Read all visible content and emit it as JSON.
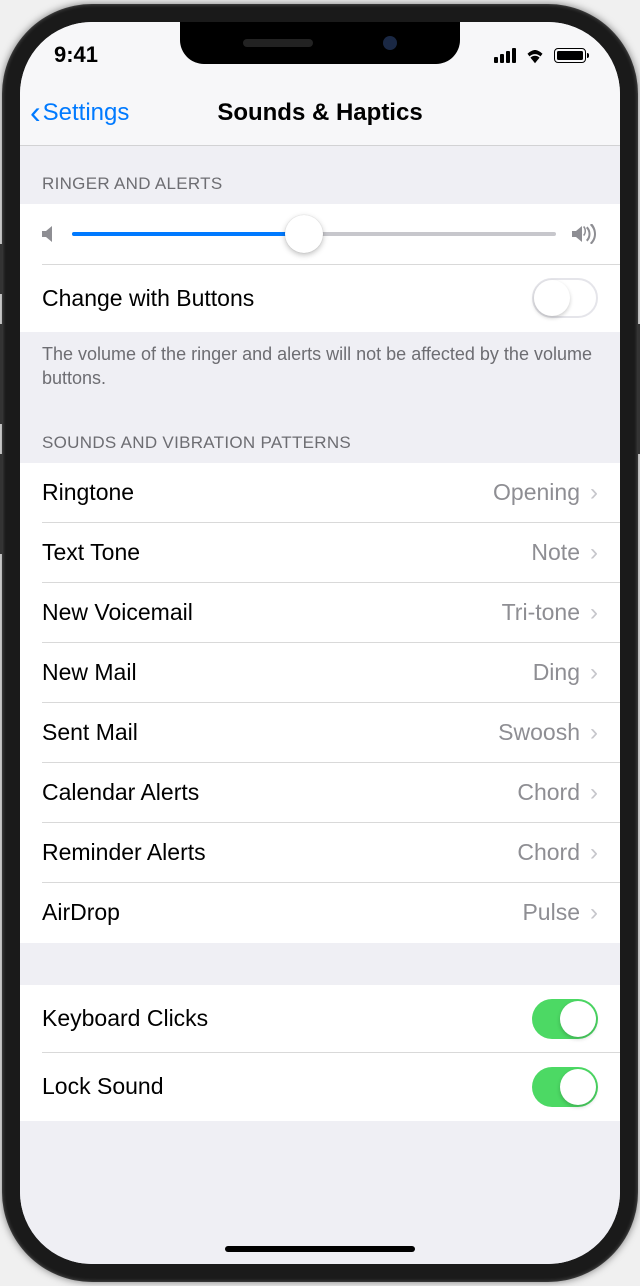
{
  "status": {
    "time": "9:41"
  },
  "nav": {
    "back_label": "Settings",
    "title": "Sounds & Haptics"
  },
  "ringer": {
    "header": "RINGER AND ALERTS",
    "change_with_buttons_label": "Change with Buttons",
    "change_with_buttons_on": false,
    "volume_percent": 48,
    "footer": "The volume of the ringer and alerts will not be affected by the volume buttons."
  },
  "patterns": {
    "header": "SOUNDS AND VIBRATION PATTERNS",
    "items": [
      {
        "label": "Ringtone",
        "value": "Opening"
      },
      {
        "label": "Text Tone",
        "value": "Note"
      },
      {
        "label": "New Voicemail",
        "value": "Tri-tone"
      },
      {
        "label": "New Mail",
        "value": "Ding"
      },
      {
        "label": "Sent Mail",
        "value": "Swoosh"
      },
      {
        "label": "Calendar Alerts",
        "value": "Chord"
      },
      {
        "label": "Reminder Alerts",
        "value": "Chord"
      },
      {
        "label": "AirDrop",
        "value": "Pulse"
      }
    ]
  },
  "system": {
    "keyboard_clicks_label": "Keyboard Clicks",
    "keyboard_clicks_on": true,
    "lock_sound_label": "Lock Sound",
    "lock_sound_on": true
  }
}
